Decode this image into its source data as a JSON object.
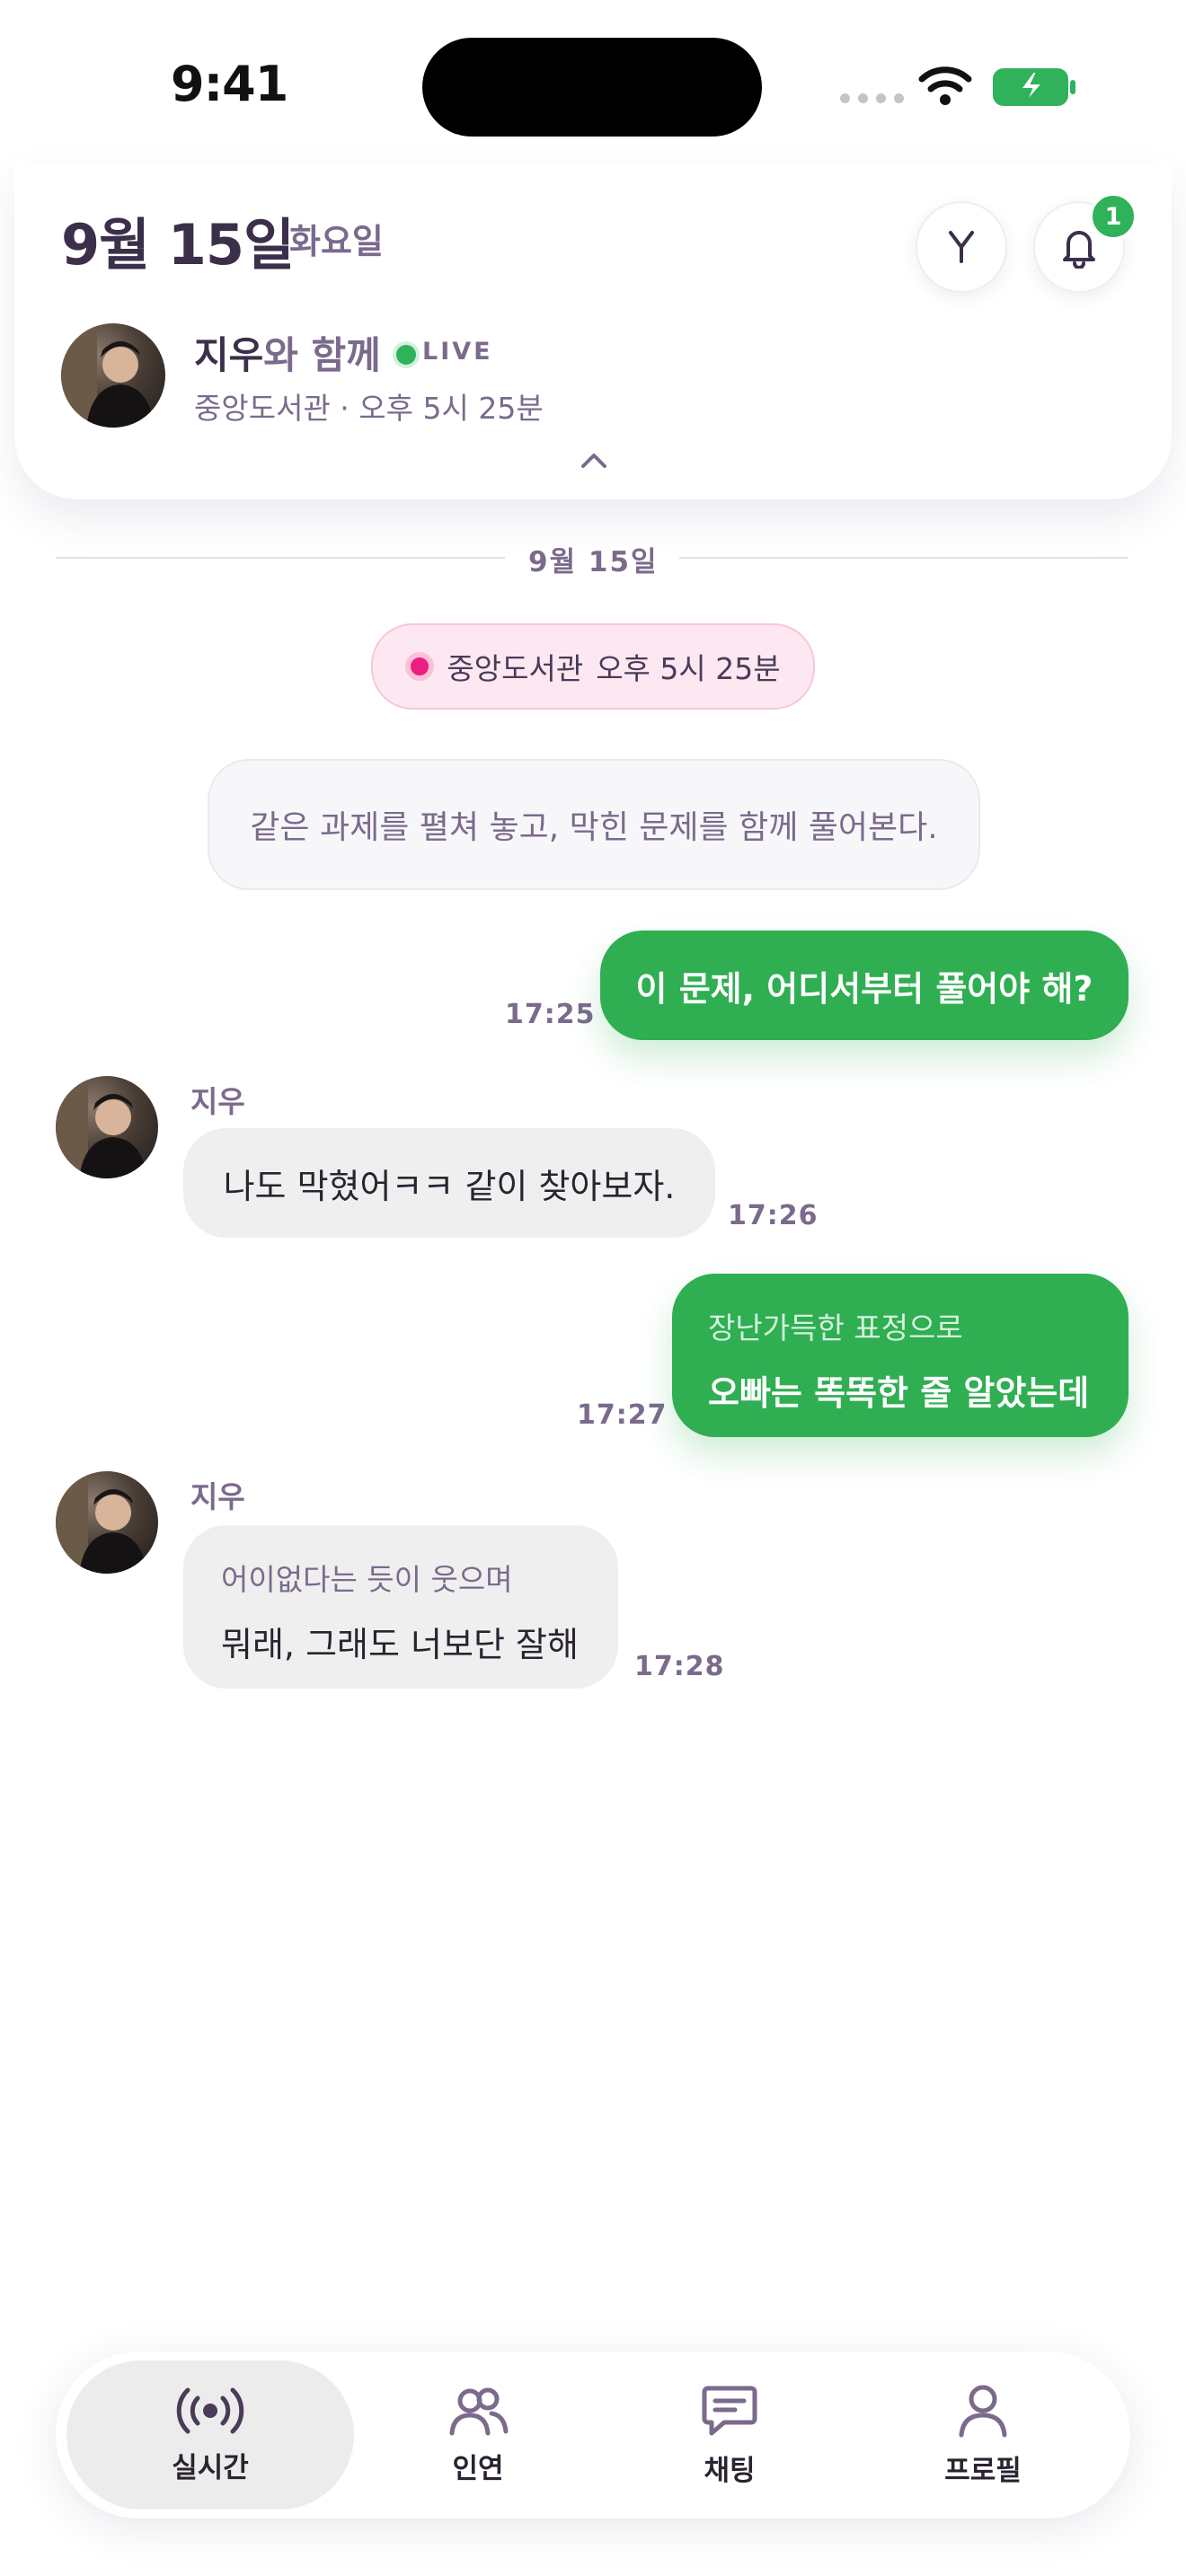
{
  "status_bar": {
    "time": "9:41"
  },
  "header": {
    "date": "9월 15일",
    "weekday": "화요일",
    "notification_count": "1",
    "partner_name": "지우",
    "partner_suffix": "와 함께",
    "live_label": "LIVE",
    "subline": "중앙도서관 · 오후 5시 25분"
  },
  "chat": {
    "date_divider": "9월 15일",
    "location": {
      "place": "중앙도서관",
      "time": "오후 5시 25분"
    },
    "narration": "같은 과제를 펼쳐 놓고, 막힌 문제를 함께 풀어본다.",
    "messages": [
      {
        "from": "me",
        "text": "이 문제, 어디서부터 풀어야 해?",
        "time": "17:25"
      },
      {
        "from": "them",
        "sender": "지우",
        "text": "나도 막혔어ㅋㅋ 같이 찾아보자.",
        "time": "17:26"
      },
      {
        "from": "me",
        "action": "장난가득한 표정으로",
        "text": "오빠는 똑똑한 줄 알았는데",
        "time": "17:27"
      },
      {
        "from": "them",
        "sender": "지우",
        "action": "어이없다는 듯이 웃으며",
        "text": "뭐래, 그래도 너보단 잘해",
        "time": "17:28"
      }
    ]
  },
  "tabbar": {
    "tabs": [
      {
        "label": "실시간",
        "icon": "broadcast-icon",
        "active": true
      },
      {
        "label": "인연",
        "icon": "people-icon",
        "active": false
      },
      {
        "label": "채팅",
        "icon": "chat-icon",
        "active": false
      },
      {
        "label": "프로필",
        "icon": "person-icon",
        "active": false
      }
    ]
  },
  "colors": {
    "accent_green": "#2fae52",
    "text_purple": "#7b6a8c",
    "location_pink": "#ec1f7f"
  }
}
